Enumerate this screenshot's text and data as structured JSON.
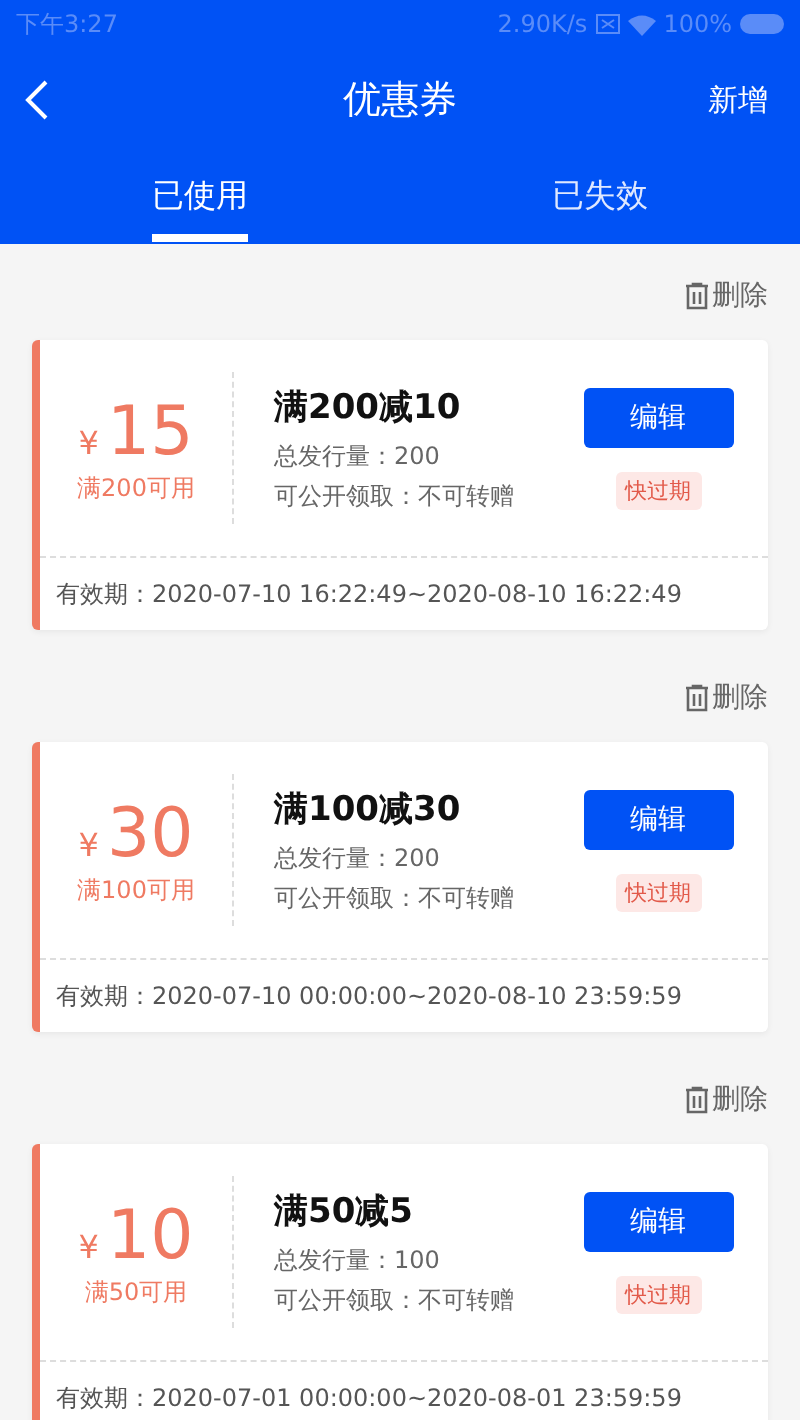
{
  "status_bar": {
    "time": "下午3:27",
    "speed": "2.90K/s",
    "battery": "100%"
  },
  "header": {
    "title": "优惠券",
    "action": "新增"
  },
  "tabs": [
    {
      "label": "已使用",
      "selected": true
    },
    {
      "label": "已失效",
      "selected": false
    }
  ],
  "coupons": [
    {
      "delete": "删除",
      "symbol": "¥",
      "amount": "15",
      "condition": "满200可用",
      "name": "满200减10",
      "issued": "总发行量：200",
      "claim": "可公开领取：不可转赠",
      "edit": "编辑",
      "tag": "快过期",
      "validity": "有效期：2020-07-10 16:22:49~2020-08-10 16:22:49"
    },
    {
      "delete": "删除",
      "symbol": "¥",
      "amount": "30",
      "condition": "满100可用",
      "name": "满100减30",
      "issued": "总发行量：200",
      "claim": "可公开领取：不可转赠",
      "edit": "编辑",
      "tag": "快过期",
      "validity": "有效期：2020-07-10 00:00:00~2020-08-10 23:59:59"
    },
    {
      "delete": "删除",
      "symbol": "¥",
      "amount": "10",
      "condition": "满50可用",
      "name": "满50减5",
      "issued": "总发行量：100",
      "claim": "可公开领取：不可转赠",
      "edit": "编辑",
      "tag": "快过期",
      "validity": "有效期：2020-07-01 00:00:00~2020-08-01 23:59:59"
    }
  ]
}
